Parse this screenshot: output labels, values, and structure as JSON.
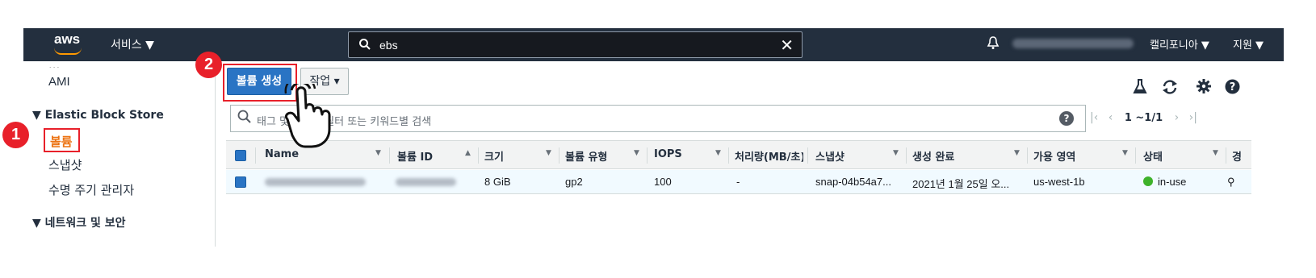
{
  "topnav": {
    "logo": "aws",
    "services_label": "서비스 ▼",
    "search_value": "ebs",
    "region_label": "캘리포니아 ▼",
    "support_label": "지원 ▼"
  },
  "sidebar": {
    "items": [
      {
        "label": "AMI"
      },
      {
        "label": "▼ Elastic Block Store"
      },
      {
        "label": "볼륨"
      },
      {
        "label": "스냅샷"
      },
      {
        "label": "수명 주기 관리자"
      },
      {
        "label": "▼ 네트워크 및 보안"
      }
    ]
  },
  "annotations": {
    "step1": "1",
    "step2": "2"
  },
  "toolbar": {
    "create_label": "볼륨 생성",
    "actions_label": "작업 ▾"
  },
  "filter": {
    "placeholder": "태그 및 속성별 필터 또는 키워드별 검색",
    "help": "?"
  },
  "pagination": {
    "range": "1 ~1/1"
  },
  "table": {
    "columns": [
      "Name",
      "볼륨 ID",
      "크기",
      "볼륨 유형",
      "IOPS",
      "처리량(MB/초)",
      "스냅샷",
      "생성 완료",
      "가용 영역",
      "상태",
      "경"
    ],
    "rows": [
      {
        "size": "8 GiB",
        "type": "gp2",
        "iops": "100",
        "throughput": "-",
        "snapshot": "snap-04b54a7...",
        "created": "2021년 1월 25일 오...",
        "az": "us-west-1b",
        "state": "in-use"
      }
    ]
  },
  "colors": {
    "nav_bg": "#232f3e",
    "primary_button": "#2a74c4",
    "highlight_red": "#e8202a",
    "active_orange": "#ec7211",
    "status_green": "#3eb22b"
  }
}
